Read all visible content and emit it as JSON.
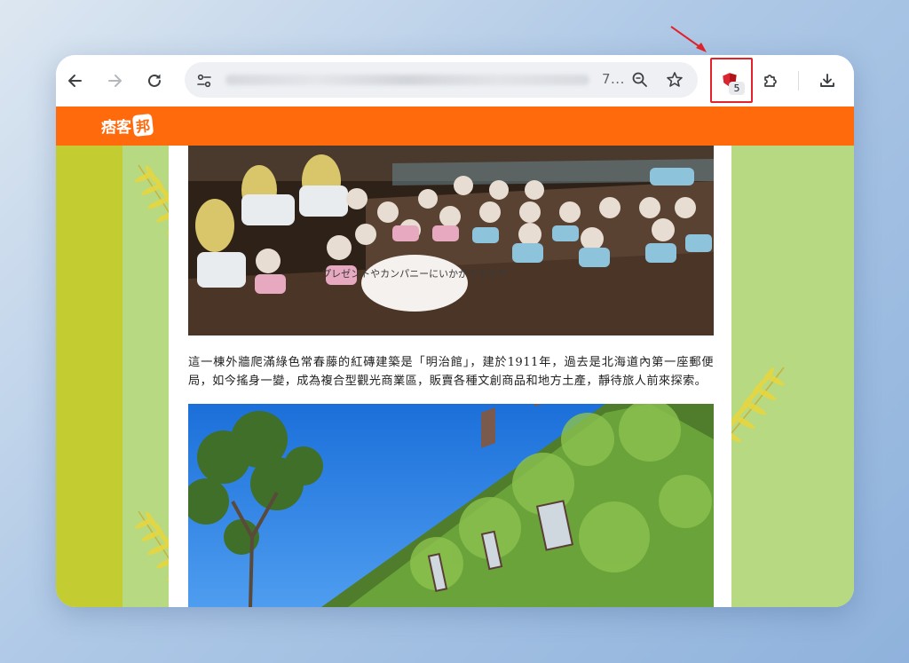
{
  "browser": {
    "url_tail": "7...",
    "extension_badge_count": "5"
  },
  "site": {
    "logo_text": "痞客",
    "logo_mark": "邦"
  },
  "article": {
    "paragraph": "這一棟外牆爬滿綠色常春藤的紅磚建築是「明治館」，建於1911年，過去是北海道內第一座郵便局，如今搖身一變，成為複合型觀光商業區，販賣各種文創商品和地方土產，靜待旅人前來探索。",
    "photo1_sign_text": "プレゼントやカンパニーにいかがですか??"
  },
  "colors": {
    "header_orange": "#ff6a0d",
    "side_green_dark": "#c3cd32",
    "side_green_light": "#b7d982",
    "highlight_red": "#e3222a"
  }
}
